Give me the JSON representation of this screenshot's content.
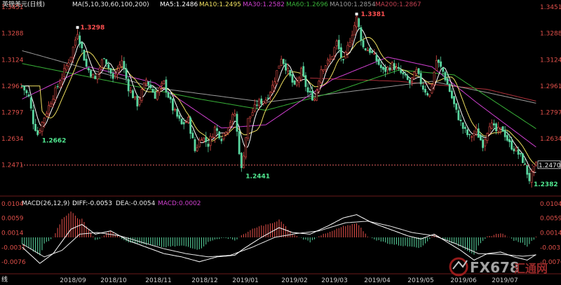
{
  "colors": {
    "background": "#000000",
    "up": "#e8504a",
    "down": "#5ad6a0",
    "axis_text_price": "#e0504a",
    "axis_text_macd": "#e0504a",
    "time_text": "#cfcfcf",
    "ma5": "#ffffff",
    "ma10": "#f0e060",
    "ma30": "#d040d0",
    "ma60": "#38b038",
    "ma100": "#9a9a9a",
    "ma200": "#b0303a",
    "diff": "#ffffff",
    "dea": "#e8e8e8",
    "current_price_line": "#e06060",
    "annotation_max": "#ff5050",
    "annotation_min": "#50e890"
  },
  "header": {
    "symbol": "英镑美元(日线)",
    "ma_label": "MA(5,10,30,60,100,200)",
    "ma5": "MA5:1.2486",
    "ma10": "MA10:1.2495",
    "ma30": "MA30:1.2582",
    "ma60": "MA60:1.2696",
    "ma100": "MA100:1.2854",
    "ma200": "MA200:1.2867"
  },
  "macd_header": {
    "label": "MACD(26,12,9)",
    "diff": "DIFF:-0.0053",
    "dea": "DEA:-0.0054",
    "macd": "MACD:0.0002"
  },
  "corner_label": "线",
  "current_price": "1.2470",
  "annotations": {
    "max_price": "1.3381",
    "min_price": "1.2382",
    "local_low_a": "1.2662",
    "local_high_b": "1.3298",
    "local_low_c": "1.2441"
  },
  "logo": {
    "text": "FX678",
    "cn": "汇通网"
  },
  "chart_data": {
    "type": "candlestick",
    "title": "英镑美元(日线)",
    "price_axis": {
      "ticks": [
        1.3451,
        1.3288,
        1.3124,
        1.2961,
        1.2797,
        1.2634,
        1.2471
      ],
      "ylim": [
        1.233,
        1.3451
      ]
    },
    "macd_axis": {
      "ticks": [
        0.0104,
        0.0059,
        0.0014,
        -0.0031,
        -0.0076
      ],
      "ylim": [
        -0.011,
        0.011
      ]
    },
    "x_ticks": [
      "2018/09",
      "2018/10",
      "2018/11",
      "2018/12",
      "2019/01",
      "2019/02",
      "2019/03",
      "2019/04",
      "2019/05",
      "2019/06",
      "2019/07"
    ],
    "close_path": [
      [
        0,
        1.2961
      ],
      [
        3,
        1.289
      ],
      [
        5,
        1.274
      ],
      [
        7,
        1.2662
      ],
      [
        10,
        1.277
      ],
      [
        14,
        1.29
      ],
      [
        18,
        1.302
      ],
      [
        22,
        1.315
      ],
      [
        25,
        1.3298
      ],
      [
        29,
        1.308
      ],
      [
        33,
        1.3
      ],
      [
        37,
        1.315
      ],
      [
        41,
        1.3
      ],
      [
        45,
        1.312
      ],
      [
        48,
        1.295
      ],
      [
        52,
        1.285
      ],
      [
        56,
        1.3
      ],
      [
        60,
        1.29
      ],
      [
        64,
        1.298
      ],
      [
        68,
        1.282
      ],
      [
        72,
        1.272
      ],
      [
        75,
        1.275
      ],
      [
        78,
        1.256
      ],
      [
        81,
        1.265
      ],
      [
        84,
        1.26
      ],
      [
        87,
        1.27
      ],
      [
        90,
        1.264
      ],
      [
        93,
        1.272
      ],
      [
        96,
        1.279
      ],
      [
        99,
        1.2441
      ],
      [
        102,
        1.275
      ],
      [
        106,
        1.285
      ],
      [
        110,
        1.288
      ],
      [
        113,
        1.296
      ],
      [
        117,
        1.314
      ],
      [
        120,
        1.305
      ],
      [
        123,
        1.295
      ],
      [
        126,
        1.305
      ],
      [
        129,
        1.292
      ],
      [
        132,
        1.288
      ],
      [
        135,
        1.307
      ],
      [
        139,
        1.312
      ],
      [
        142,
        1.323
      ],
      [
        145,
        1.31
      ],
      [
        148,
        1.325
      ],
      [
        151,
        1.3381
      ],
      [
        154,
        1.32
      ],
      [
        157,
        1.318
      ],
      [
        160,
        1.312
      ],
      [
        163,
        1.305
      ],
      [
        167,
        1.309
      ],
      [
        171,
        1.304
      ],
      [
        175,
        1.298
      ],
      [
        178,
        1.305
      ],
      [
        181,
        1.295
      ],
      [
        184,
        1.29
      ],
      [
        187,
        1.312
      ],
      [
        190,
        1.305
      ],
      [
        193,
        1.293
      ],
      [
        196,
        1.28
      ],
      [
        199,
        1.27
      ],
      [
        202,
        1.264
      ],
      [
        205,
        1.268
      ],
      [
        208,
        1.26
      ],
      [
        211,
        1.273
      ],
      [
        214,
        1.268
      ],
      [
        217,
        1.269
      ],
      [
        220,
        1.26
      ],
      [
        223,
        1.256
      ],
      [
        226,
        1.25
      ],
      [
        229,
        1.2382
      ],
      [
        232,
        1.247
      ]
    ],
    "ma_paths": {
      "ma30": [
        [
          0,
          1.288
        ],
        [
          30,
          1.308
        ],
        [
          60,
          1.298
        ],
        [
          90,
          1.27
        ],
        [
          110,
          1.272
        ],
        [
          140,
          1.3
        ],
        [
          165,
          1.314
        ],
        [
          185,
          1.308
        ],
        [
          205,
          1.286
        ],
        [
          232,
          1.2582
        ]
      ],
      "ma60": [
        [
          0,
          1.31
        ],
        [
          40,
          1.299
        ],
        [
          80,
          1.288
        ],
        [
          110,
          1.281
        ],
        [
          140,
          1.292
        ],
        [
          170,
          1.306
        ],
        [
          195,
          1.303
        ],
        [
          232,
          1.2696
        ]
      ],
      "ma100": [
        [
          0,
          1.318
        ],
        [
          60,
          1.295
        ],
        [
          110,
          1.286
        ],
        [
          150,
          1.293
        ],
        [
          185,
          1.299
        ],
        [
          210,
          1.292
        ],
        [
          232,
          1.2854
        ]
      ],
      "ma200": [
        [
          130,
          1.301
        ],
        [
          170,
          1.299
        ],
        [
          210,
          1.294
        ],
        [
          232,
          1.2867
        ]
      ]
    },
    "macd_diff_path": [
      [
        0,
        -0.003
      ],
      [
        8,
        -0.008
      ],
      [
        14,
        -0.005
      ],
      [
        22,
        0.0025
      ],
      [
        27,
        0.004
      ],
      [
        33,
        0.001
      ],
      [
        40,
        0.002
      ],
      [
        48,
        -0.001
      ],
      [
        56,
        -0.003
      ],
      [
        64,
        -0.005
      ],
      [
        72,
        -0.006
      ],
      [
        80,
        -0.0075
      ],
      [
        88,
        -0.006
      ],
      [
        96,
        -0.0055
      ],
      [
        100,
        -0.0035
      ],
      [
        108,
        0.0
      ],
      [
        116,
        0.003
      ],
      [
        122,
        0.0015
      ],
      [
        130,
        0.001
      ],
      [
        138,
        0.0035
      ],
      [
        145,
        0.006
      ],
      [
        151,
        0.007
      ],
      [
        158,
        0.0045
      ],
      [
        166,
        0.0025
      ],
      [
        174,
        0.0005
      ],
      [
        180,
        -0.0005
      ],
      [
        186,
        0.001
      ],
      [
        192,
        -0.0015
      ],
      [
        198,
        -0.004
      ],
      [
        204,
        -0.007
      ],
      [
        210,
        -0.005
      ],
      [
        216,
        -0.0045
      ],
      [
        222,
        -0.006
      ],
      [
        228,
        -0.007
      ],
      [
        232,
        -0.0053
      ]
    ],
    "macd_dea_path": [
      [
        0,
        -0.002
      ],
      [
        10,
        -0.006
      ],
      [
        18,
        -0.004
      ],
      [
        26,
        0.001
      ],
      [
        34,
        0.0015
      ],
      [
        44,
        0.0005
      ],
      [
        54,
        -0.0015
      ],
      [
        64,
        -0.0035
      ],
      [
        74,
        -0.005
      ],
      [
        84,
        -0.006
      ],
      [
        94,
        -0.0055
      ],
      [
        104,
        -0.003
      ],
      [
        114,
        0.0
      ],
      [
        124,
        0.0012
      ],
      [
        134,
        0.002
      ],
      [
        146,
        0.0045
      ],
      [
        156,
        0.005
      ],
      [
        166,
        0.0035
      ],
      [
        176,
        0.0015
      ],
      [
        186,
        0.0005
      ],
      [
        196,
        -0.002
      ],
      [
        206,
        -0.005
      ],
      [
        216,
        -0.0052
      ],
      [
        226,
        -0.0058
      ],
      [
        232,
        -0.0054
      ]
    ]
  }
}
